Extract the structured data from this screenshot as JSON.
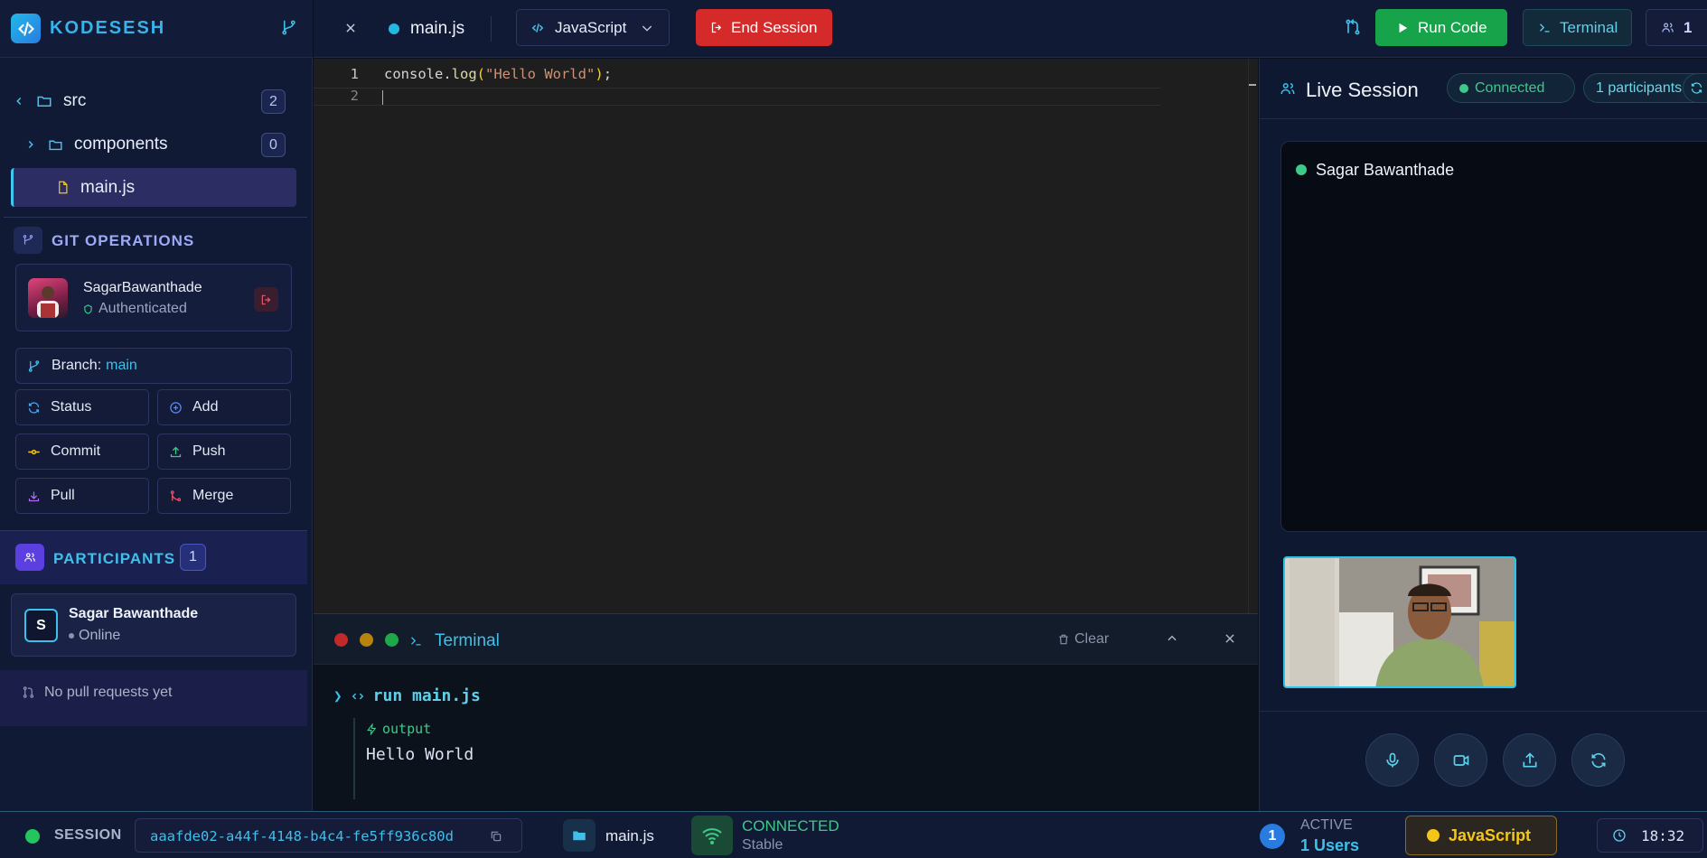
{
  "brand": {
    "name": "KODESESH"
  },
  "files": {
    "src": {
      "label": "src",
      "count": "2"
    },
    "components": {
      "label": "components",
      "count": "0"
    },
    "main": {
      "label": "main.js"
    }
  },
  "git": {
    "title": "GIT OPERATIONS",
    "user": "SagarBawanthade",
    "auth": "Authenticated",
    "branch_label": "Branch:",
    "branch": "main",
    "buttons": {
      "status": "Status",
      "add": "Add",
      "commit": "Commit",
      "push": "Push",
      "pull": "Pull",
      "merge": "Merge"
    }
  },
  "participants": {
    "title": "PARTICIPANTS",
    "count": "1",
    "items": [
      {
        "initial": "S",
        "name": "Sagar Bawanthade",
        "status": "Online"
      }
    ],
    "no_prs": "No pull requests yet"
  },
  "topbar": {
    "tab": "main.js",
    "language": "JavaScript",
    "end_session": "End Session",
    "run_code": "Run Code",
    "terminal": "Terminal",
    "users_count": "1"
  },
  "editor": {
    "lines": [
      {
        "num": "1"
      },
      {
        "num": "2"
      }
    ],
    "code": {
      "obj": "console",
      "dot": ".",
      "fn": "log",
      "open": "(",
      "str": "\"Hello World\"",
      "close": ")",
      "semi": ";"
    }
  },
  "terminal": {
    "title": "Terminal",
    "clear": "Clear",
    "command": "run main.js",
    "output_label": "output",
    "output": "Hello World"
  },
  "live": {
    "title": "Live Session",
    "status": "Connected",
    "participants_pill": "1 participants",
    "video_name": "Sagar Bawanthade"
  },
  "statusbar": {
    "session_label": "SESSION",
    "session_id": "aaafde02-a44f-4148-b4c4-fe5ff936c80d",
    "file": "main.js",
    "connection": "CONNECTED",
    "connection_sub": "Stable",
    "active_count": "1",
    "active_label": "ACTIVE",
    "active_users": "1 Users",
    "language": "JavaScript",
    "time": "18:32"
  },
  "colors": {
    "accent": "#37b3ea",
    "danger": "#d42a2a",
    "success": "#16a34a",
    "warning": "#f5c518"
  }
}
